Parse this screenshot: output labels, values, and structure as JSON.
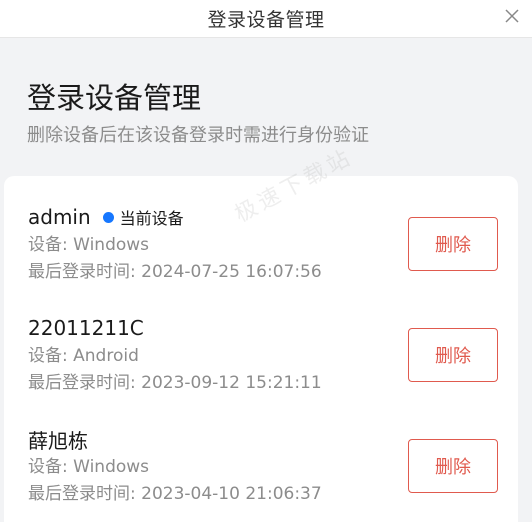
{
  "window": {
    "title": "登录设备管理",
    "close_icon": "close-icon"
  },
  "header": {
    "title": "登录设备管理",
    "subtitle": "删除设备后在该设备登录时需进行身份验证"
  },
  "watermark": "极速下载站",
  "colors": {
    "accent_blue": "#1677ff",
    "delete_red": "#e05a4e",
    "muted_text": "#8c8c8c"
  },
  "devices": [
    {
      "name": "admin",
      "current_label": "当前设备",
      "device": "设备: Windows",
      "last_login": "最后登录时间: 2024-07-25 16:07:56",
      "delete_label": "删除"
    },
    {
      "name": "22011211C",
      "device": "设备: Android",
      "last_login": "最后登录时间: 2023-09-12 15:21:11",
      "delete_label": "删除"
    },
    {
      "name": "薛旭栋",
      "device": "设备: Windows",
      "last_login": "最后登录时间: 2023-04-10 21:06:37",
      "delete_label": "删除"
    }
  ]
}
